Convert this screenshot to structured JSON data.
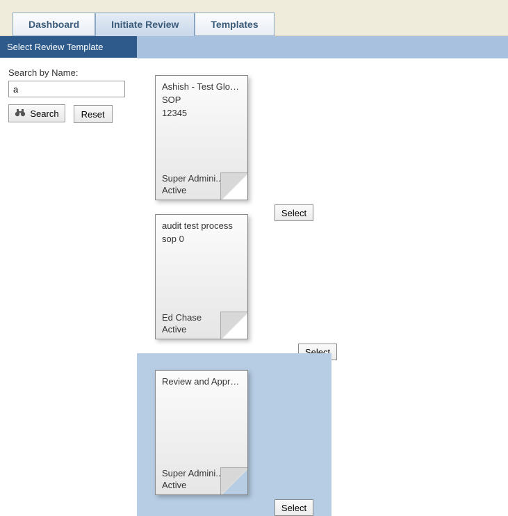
{
  "tabs": {
    "dashboard": "Dashboard",
    "initiate": "Initiate Review",
    "templates": "Templates"
  },
  "sidebar": {
    "header": "Select Review Template",
    "search_label": "Search by Name:",
    "search_value": "a",
    "search_btn": "Search",
    "reset_btn": "Reset"
  },
  "cards": [
    {
      "title": "Ashish - Test Global Co...",
      "line1": "SOP",
      "line2": "12345",
      "owner": "Super Admini...",
      "status": "Active",
      "select": "Select"
    },
    {
      "title": "audit test process",
      "line1": "sop 0",
      "line2": "",
      "owner": "Ed Chase",
      "status": "Active",
      "select": "Select"
    },
    {
      "title": "Review and Approval ...",
      "line1": "",
      "line2": "",
      "owner": "Super Admini...",
      "status": "Active",
      "select": "Select"
    }
  ]
}
